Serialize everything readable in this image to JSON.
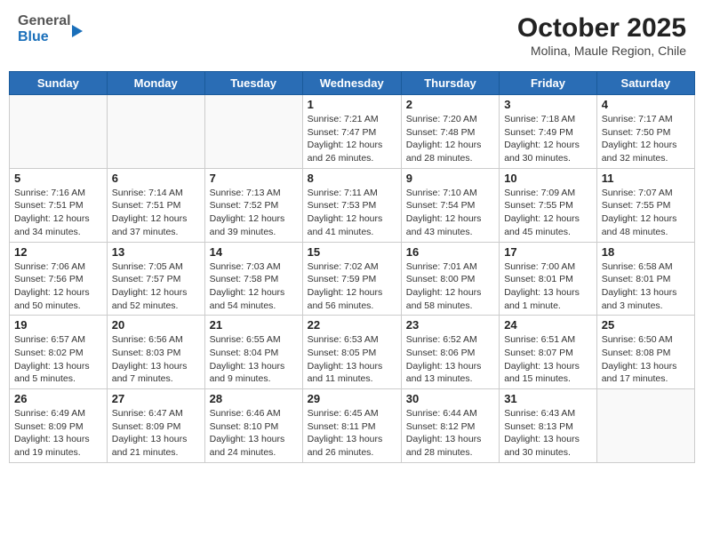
{
  "header": {
    "logo_general": "General",
    "logo_blue": "Blue",
    "month_title": "October 2025",
    "subtitle": "Molina, Maule Region, Chile"
  },
  "calendar": {
    "days_of_week": [
      "Sunday",
      "Monday",
      "Tuesday",
      "Wednesday",
      "Thursday",
      "Friday",
      "Saturday"
    ],
    "weeks": [
      [
        {
          "day": "",
          "info": ""
        },
        {
          "day": "",
          "info": ""
        },
        {
          "day": "",
          "info": ""
        },
        {
          "day": "1",
          "info": "Sunrise: 7:21 AM\nSunset: 7:47 PM\nDaylight: 12 hours\nand 26 minutes."
        },
        {
          "day": "2",
          "info": "Sunrise: 7:20 AM\nSunset: 7:48 PM\nDaylight: 12 hours\nand 28 minutes."
        },
        {
          "day": "3",
          "info": "Sunrise: 7:18 AM\nSunset: 7:49 PM\nDaylight: 12 hours\nand 30 minutes."
        },
        {
          "day": "4",
          "info": "Sunrise: 7:17 AM\nSunset: 7:50 PM\nDaylight: 12 hours\nand 32 minutes."
        }
      ],
      [
        {
          "day": "5",
          "info": "Sunrise: 7:16 AM\nSunset: 7:51 PM\nDaylight: 12 hours\nand 34 minutes."
        },
        {
          "day": "6",
          "info": "Sunrise: 7:14 AM\nSunset: 7:51 PM\nDaylight: 12 hours\nand 37 minutes."
        },
        {
          "day": "7",
          "info": "Sunrise: 7:13 AM\nSunset: 7:52 PM\nDaylight: 12 hours\nand 39 minutes."
        },
        {
          "day": "8",
          "info": "Sunrise: 7:11 AM\nSunset: 7:53 PM\nDaylight: 12 hours\nand 41 minutes."
        },
        {
          "day": "9",
          "info": "Sunrise: 7:10 AM\nSunset: 7:54 PM\nDaylight: 12 hours\nand 43 minutes."
        },
        {
          "day": "10",
          "info": "Sunrise: 7:09 AM\nSunset: 7:55 PM\nDaylight: 12 hours\nand 45 minutes."
        },
        {
          "day": "11",
          "info": "Sunrise: 7:07 AM\nSunset: 7:55 PM\nDaylight: 12 hours\nand 48 minutes."
        }
      ],
      [
        {
          "day": "12",
          "info": "Sunrise: 7:06 AM\nSunset: 7:56 PM\nDaylight: 12 hours\nand 50 minutes."
        },
        {
          "day": "13",
          "info": "Sunrise: 7:05 AM\nSunset: 7:57 PM\nDaylight: 12 hours\nand 52 minutes."
        },
        {
          "day": "14",
          "info": "Sunrise: 7:03 AM\nSunset: 7:58 PM\nDaylight: 12 hours\nand 54 minutes."
        },
        {
          "day": "15",
          "info": "Sunrise: 7:02 AM\nSunset: 7:59 PM\nDaylight: 12 hours\nand 56 minutes."
        },
        {
          "day": "16",
          "info": "Sunrise: 7:01 AM\nSunset: 8:00 PM\nDaylight: 12 hours\nand 58 minutes."
        },
        {
          "day": "17",
          "info": "Sunrise: 7:00 AM\nSunset: 8:01 PM\nDaylight: 13 hours\nand 1 minute."
        },
        {
          "day": "18",
          "info": "Sunrise: 6:58 AM\nSunset: 8:01 PM\nDaylight: 13 hours\nand 3 minutes."
        }
      ],
      [
        {
          "day": "19",
          "info": "Sunrise: 6:57 AM\nSunset: 8:02 PM\nDaylight: 13 hours\nand 5 minutes."
        },
        {
          "day": "20",
          "info": "Sunrise: 6:56 AM\nSunset: 8:03 PM\nDaylight: 13 hours\nand 7 minutes."
        },
        {
          "day": "21",
          "info": "Sunrise: 6:55 AM\nSunset: 8:04 PM\nDaylight: 13 hours\nand 9 minutes."
        },
        {
          "day": "22",
          "info": "Sunrise: 6:53 AM\nSunset: 8:05 PM\nDaylight: 13 hours\nand 11 minutes."
        },
        {
          "day": "23",
          "info": "Sunrise: 6:52 AM\nSunset: 8:06 PM\nDaylight: 13 hours\nand 13 minutes."
        },
        {
          "day": "24",
          "info": "Sunrise: 6:51 AM\nSunset: 8:07 PM\nDaylight: 13 hours\nand 15 minutes."
        },
        {
          "day": "25",
          "info": "Sunrise: 6:50 AM\nSunset: 8:08 PM\nDaylight: 13 hours\nand 17 minutes."
        }
      ],
      [
        {
          "day": "26",
          "info": "Sunrise: 6:49 AM\nSunset: 8:09 PM\nDaylight: 13 hours\nand 19 minutes."
        },
        {
          "day": "27",
          "info": "Sunrise: 6:47 AM\nSunset: 8:09 PM\nDaylight: 13 hours\nand 21 minutes."
        },
        {
          "day": "28",
          "info": "Sunrise: 6:46 AM\nSunset: 8:10 PM\nDaylight: 13 hours\nand 24 minutes."
        },
        {
          "day": "29",
          "info": "Sunrise: 6:45 AM\nSunset: 8:11 PM\nDaylight: 13 hours\nand 26 minutes."
        },
        {
          "day": "30",
          "info": "Sunrise: 6:44 AM\nSunset: 8:12 PM\nDaylight: 13 hours\nand 28 minutes."
        },
        {
          "day": "31",
          "info": "Sunrise: 6:43 AM\nSunset: 8:13 PM\nDaylight: 13 hours\nand 30 minutes."
        },
        {
          "day": "",
          "info": ""
        }
      ]
    ]
  }
}
